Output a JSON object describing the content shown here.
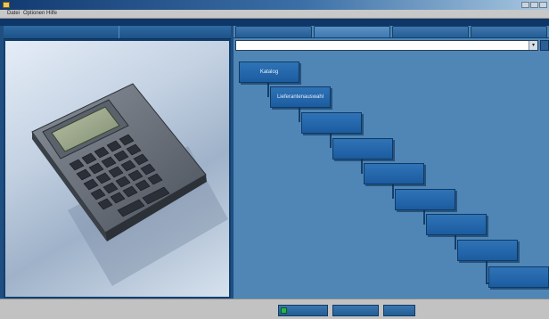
{
  "window": {
    "title": "",
    "menu": [
      "Datei",
      "Optionen",
      "Hilfe"
    ]
  },
  "left_panel": {
    "header_tabs": [
      "",
      ""
    ],
    "image_alt": "calculator-photo"
  },
  "right_panel": {
    "tabs": [
      {
        "label": "",
        "active": false
      },
      {
        "label": "",
        "active": true
      },
      {
        "label": "",
        "active": false
      },
      {
        "label": "",
        "active": false
      }
    ],
    "dropdown": {
      "value": ""
    },
    "steps": [
      {
        "label": "Katalog"
      },
      {
        "label": "Lieferantenauswahl"
      },
      {
        "label": ""
      },
      {
        "label": ""
      },
      {
        "label": ""
      },
      {
        "label": ""
      },
      {
        "label": ""
      },
      {
        "label": ""
      },
      {
        "label": ""
      }
    ]
  },
  "bottom_bar": {
    "buttons": [
      {
        "label": ""
      },
      {
        "label": ""
      },
      {
        "label": ""
      }
    ]
  },
  "colors": {
    "step_fill": "#1f62a6",
    "pane_bg": "#4f86b6",
    "window_bg": "#1f4f80"
  }
}
